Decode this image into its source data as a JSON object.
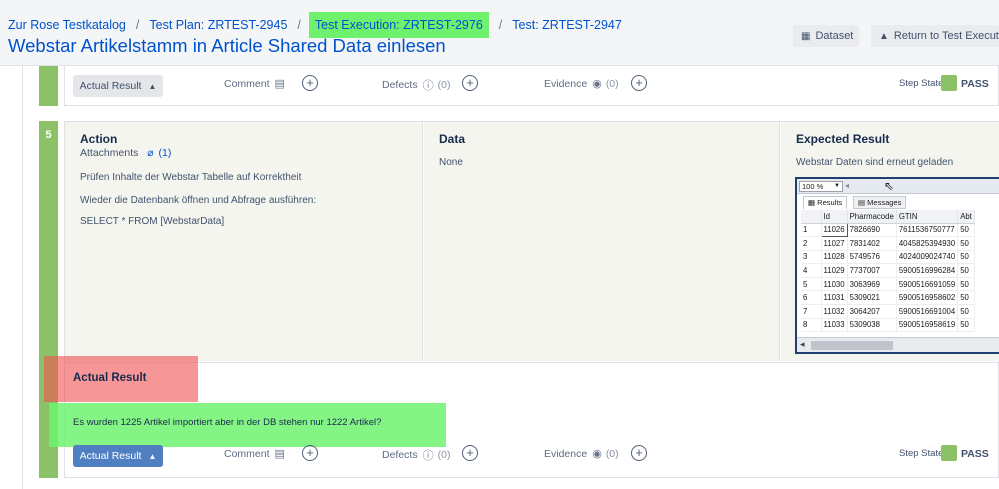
{
  "header": {
    "breadcrumb": [
      "Zur Rose Testkatalog",
      "Test Plan: ZRTEST-2945",
      "Test Execution: ZRTEST-2976",
      "Test: ZRTEST-2947"
    ],
    "separator": "/",
    "title": "Webstar Artikelstamm in Article Shared Data einlesen",
    "dataset_label": "Dataset",
    "return_label": "Return to Test Execution"
  },
  "toolbar": {
    "actual_result_label": "Actual Result",
    "comment_label": "Comment",
    "defects_label": "Defects",
    "defects_count": "(0)",
    "evidence_label": "Evidence",
    "evidence_count": "(0)",
    "step_state_label": "Step State",
    "step_state_value": "PASS"
  },
  "step": {
    "number": "5",
    "action_title": "Action",
    "attachments_label": "Attachments",
    "attachments_count": "(1)",
    "action_lines": [
      "Prüfen Inhalte der Webstar Tabelle auf Korrektheit",
      "Wieder die Datenbank öffnen und Abfrage ausführen:",
      "SELECT * FROM [WebstarData]"
    ],
    "data_title": "Data",
    "data_value": "None",
    "expected_title": "Expected Result",
    "expected_value": "Webstar Daten sind erneut geladen"
  },
  "query_window": {
    "zoom": "100 %",
    "tabs": [
      "Results",
      "Messages"
    ],
    "columns": [
      "",
      "Id",
      "Pharmacode",
      "GTIN",
      "Abt"
    ],
    "rows": [
      [
        "1",
        "11026",
        "7826690",
        "7611536750777",
        "50"
      ],
      [
        "2",
        "11027",
        "7831402",
        "4045825394930",
        "50"
      ],
      [
        "3",
        "11028",
        "5749576",
        "4024009024740",
        "50"
      ],
      [
        "4",
        "11029",
        "7737007",
        "5900516996284",
        "50"
      ],
      [
        "5",
        "11030",
        "3063969",
        "5900516691059",
        "50"
      ],
      [
        "6",
        "11031",
        "5309021",
        "5900516958602",
        "50"
      ],
      [
        "7",
        "11032",
        "3064207",
        "5900516691004",
        "50"
      ],
      [
        "8",
        "11033",
        "5309038",
        "5900516958619",
        "50"
      ]
    ]
  },
  "actual_result": {
    "title": "Actual Result",
    "text": "Es wurden 1225 Artikel importiert aber in der DB stehen  nur 1222 Artikel?"
  },
  "colors": {
    "link": "#0052cc",
    "pass": "#8cc267",
    "highlight_green": "#6ef26e",
    "highlight_red": "#f05050",
    "button_blue": "#4f7fc0"
  }
}
